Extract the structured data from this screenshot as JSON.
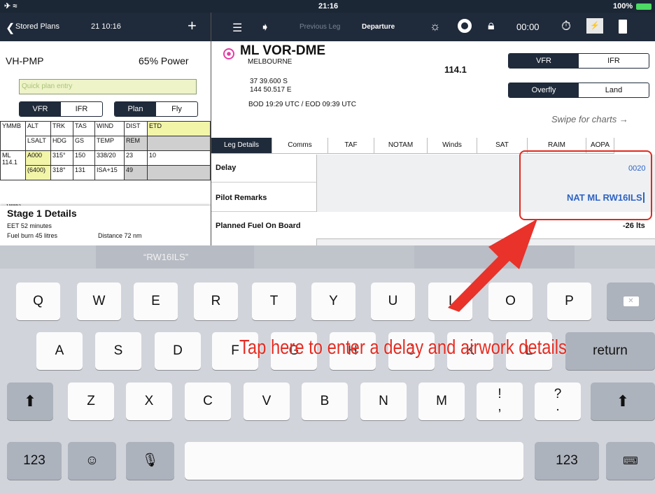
{
  "status": {
    "time": "21:16",
    "battery": "100%"
  },
  "left_header": {
    "back": "Stored Plans",
    "time": "21 10:16",
    "add": "+"
  },
  "plan": {
    "aircraft": "VH-PMP",
    "power": "65% Power",
    "quick_placeholder": "Quick plan entry",
    "vfr": "VFR",
    "ifr": "IFR",
    "plan": "Plan",
    "fly": "Fly"
  },
  "nav_table": {
    "headers": [
      "YMMB",
      "ALT",
      "TRK",
      "TAS",
      "WIND",
      "DIST",
      "ETD"
    ],
    "headers2": [
      "",
      "LSALT",
      "HDG",
      "GS",
      "TEMP",
      "REM",
      ""
    ],
    "row1": [
      "ML\n114.1",
      "A000",
      "315°",
      "150",
      "338/20",
      "23",
      "10"
    ],
    "row2": [
      "",
      "(6400)",
      "318°",
      "131",
      "ISA+15",
      "49",
      ""
    ],
    "cut": "YMMG"
  },
  "stage": {
    "title": "Stage 1 Details",
    "eet": "EET 52 minutes",
    "fuel": "Fuel burn 45 litres",
    "distance": "Distance 72 nm"
  },
  "toolbar": {
    "prev": "Previous Leg",
    "departure": "Departure",
    "timer": "00:00"
  },
  "waypoint": {
    "name": "ML VOR-DME",
    "city": "MELBOURNE",
    "freq": "114.1",
    "lat": "37 39.600 S",
    "lon": "144 50.517 E",
    "times": "BOD 19:29 UTC / EOD 09:39 UTC",
    "swipe": "Swipe for charts →",
    "vfr": "VFR",
    "ifr": "IFR",
    "overfly": "Overfly",
    "land": "Land"
  },
  "tabs": [
    "Leg Details",
    "Comms",
    "TAF",
    "NOTAM",
    "Winds",
    "SAT",
    "RAIM",
    "AOPA"
  ],
  "fields": {
    "delay_label": "Delay",
    "delay_value": "0020",
    "remarks_label": "Pilot Remarks",
    "remarks_value": "NAT ML RW16ILS",
    "fuel_label": "Planned Fuel On Board",
    "fuel_value": "-26 lts"
  },
  "prediction": "“RW16ILS”",
  "keyboard": {
    "row1": [
      "Q",
      "W",
      "E",
      "R",
      "T",
      "Y",
      "U",
      "I",
      "O",
      "P"
    ],
    "row2": [
      "A",
      "S",
      "D",
      "F",
      "G",
      "H",
      "J",
      "K",
      "L"
    ],
    "row3": [
      "Z",
      "X",
      "C",
      "V",
      "B",
      "N",
      "M",
      "!\n,",
      "?\n."
    ],
    "num": "123",
    "ret": "return",
    "num2": "123"
  },
  "annotation": "Tap here to enter a delay and airwork details",
  "colors": {
    "annotation": "#e52c22",
    "header": "#1f2a3a"
  }
}
